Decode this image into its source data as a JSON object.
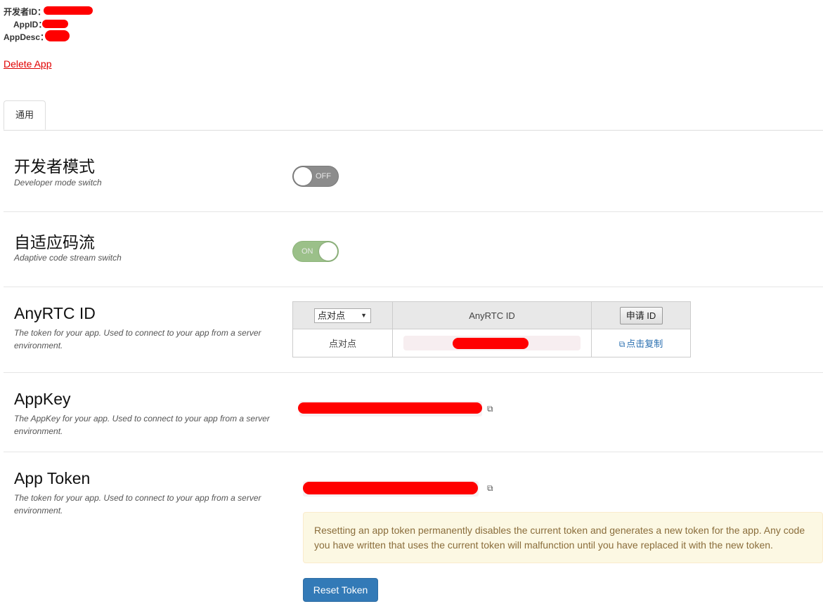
{
  "header": {
    "developer_id_label": "开发者ID：",
    "app_id_label": "AppID：",
    "app_desc_label": "AppDesc：",
    "delete_link": "Delete App"
  },
  "tabs": [
    {
      "label": "通用",
      "active": true
    }
  ],
  "sections": {
    "developer_mode": {
      "title": "开发者模式",
      "desc": "Developer mode switch",
      "toggle_label": "OFF",
      "enabled": false
    },
    "adaptive_stream": {
      "title": "自适应码流",
      "desc": "Adaptive code stream switch",
      "toggle_label": "ON",
      "enabled": true
    },
    "anyrtc_id": {
      "title": "AnyRTC ID",
      "desc": "The token for your app. Used to connect to your app from a server environment.",
      "table": {
        "select_value": "点对点",
        "col_header": "AnyRTC ID",
        "apply_button": "申请 ID",
        "row_type": "点对点",
        "copy_link": "点击复制"
      }
    },
    "appkey": {
      "title": "AppKey",
      "desc": "The AppKey for your app. Used to connect to your app from a server environment."
    },
    "app_token": {
      "title": "App Token",
      "desc": "The token for your app. Used to connect to your app from a server environment.",
      "warning": "Resetting an app token permanently disables the current token and generates a new token for the app. Any code you have written that uses the current token will malfunction until you have replaced it with the new token.",
      "reset_button": "Reset Token"
    }
  },
  "colors": {
    "link_red": "#e00000",
    "toggle_off": "#8c8c8c",
    "toggle_on": "#9bc089",
    "primary_button": "#337ab7",
    "alert_bg": "#fcf8e3",
    "alert_text": "#8a6d3b",
    "copy_link": "#2a6fb0"
  }
}
